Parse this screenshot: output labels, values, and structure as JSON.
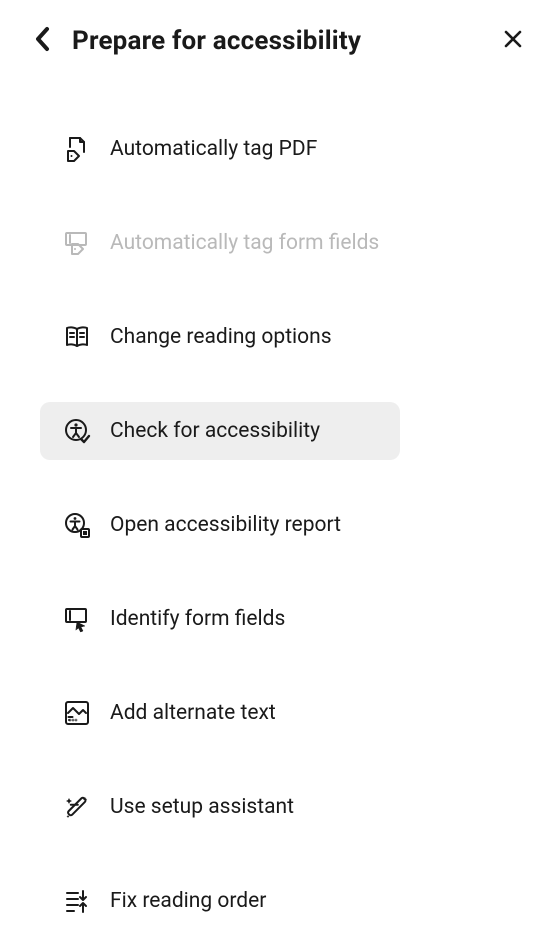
{
  "header": {
    "title": "Prepare for accessibility"
  },
  "menu": {
    "items": [
      {
        "label": "Automatically tag PDF"
      },
      {
        "label": "Automatically tag form fields"
      },
      {
        "label": "Change reading options"
      },
      {
        "label": "Check for accessibility"
      },
      {
        "label": "Open accessibility report"
      },
      {
        "label": "Identify form fields"
      },
      {
        "label": "Add alternate text"
      },
      {
        "label": "Use setup assistant"
      },
      {
        "label": "Fix reading order"
      }
    ]
  }
}
